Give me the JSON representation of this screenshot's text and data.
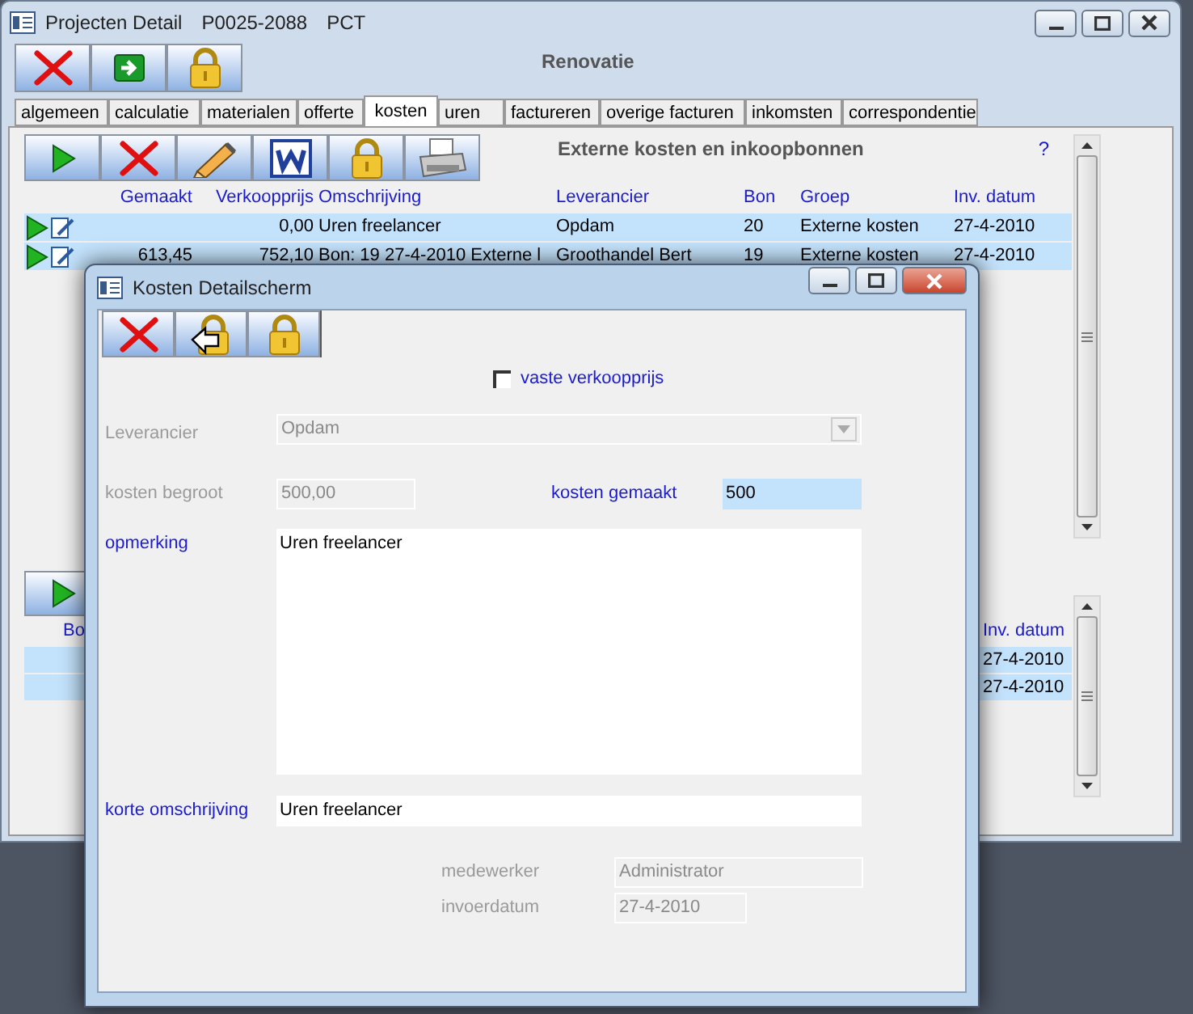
{
  "main_window": {
    "title": [
      "Projecten Detail",
      "P0025-2088",
      "PCT"
    ],
    "toolbar": [
      {
        "kind": "close"
      },
      {
        "kind": "next"
      },
      {
        "kind": "lock"
      }
    ],
    "heading": "Renovatie",
    "tabs": [
      {
        "label": "algemeen",
        "selected": false
      },
      {
        "label": "calculatie",
        "selected": false
      },
      {
        "label": "materialen",
        "selected": false
      },
      {
        "label": "offerte",
        "selected": false
      },
      {
        "label": "kosten",
        "selected": true
      },
      {
        "label": "uren",
        "selected": false
      },
      {
        "label": "factureren",
        "selected": false
      },
      {
        "label": "overige facturen",
        "selected": false
      },
      {
        "label": "inkomsten",
        "selected": false
      },
      {
        "label": "correspondentie",
        "selected": false
      }
    ],
    "panel_toolbar": [
      {
        "kind": "play"
      },
      {
        "kind": "close"
      },
      {
        "kind": "edit"
      },
      {
        "kind": "document"
      },
      {
        "kind": "lock"
      },
      {
        "kind": "print"
      }
    ],
    "section_title": "Externe kosten en inkoopbonnen",
    "help": "?",
    "table": {
      "columns": [
        "Gemaakt",
        "Verkoopprijs",
        "Omschrijving",
        "Leverancier",
        "Bon",
        "Groep",
        "Inv. datum"
      ],
      "rows": [
        {
          "cells": [
            "",
            "0,00",
            "Uren freelancer",
            "Opdam",
            "20",
            "Externe kosten",
            "27-4-2010"
          ]
        },
        {
          "cells": [
            "613,45",
            "752,10",
            "Bon: 19 27-4-2010 Externe l",
            "Groothandel Bert",
            "19",
            "Externe kosten",
            "27-4-2010"
          ]
        }
      ]
    },
    "lower_toolbar": [
      {
        "kind": "play"
      }
    ],
    "lower_table": {
      "columns": [
        "Bo",
        "Inv. datum"
      ],
      "rows": [
        {
          "cells": [
            "27-4-2010"
          ]
        },
        {
          "cells": [
            "27-4-2010"
          ]
        }
      ]
    }
  },
  "dialog": {
    "title": "Kosten Detailscherm",
    "toolbar": [
      {
        "kind": "close"
      },
      {
        "kind": "unlock"
      },
      {
        "kind": "lock"
      }
    ],
    "checkbox": {
      "label": "vaste verkoopprijs",
      "checked": false
    },
    "leverancier": {
      "label": "Leverancier",
      "value": "Opdam",
      "disabled": true
    },
    "kosten_begroot": {
      "label": "kosten begroot",
      "value": "500,00",
      "disabled": true
    },
    "kosten_gemaakt": {
      "label": "kosten gemaakt",
      "value": "500",
      "disabled": false,
      "focused": true
    },
    "opmerking": {
      "label": "opmerking",
      "value": "Uren freelancer",
      "disabled": false,
      "focused": false
    },
    "korte_omschrijving": {
      "label": "korte omschrijving",
      "value": "Uren freelancer",
      "disabled": false,
      "focused": false
    },
    "medewerker": {
      "label": "medewerker",
      "value": "Administrator",
      "disabled": true
    },
    "invoerdatum": {
      "label": "invoerdatum",
      "value": "27-4-2010",
      "disabled": true
    }
  }
}
